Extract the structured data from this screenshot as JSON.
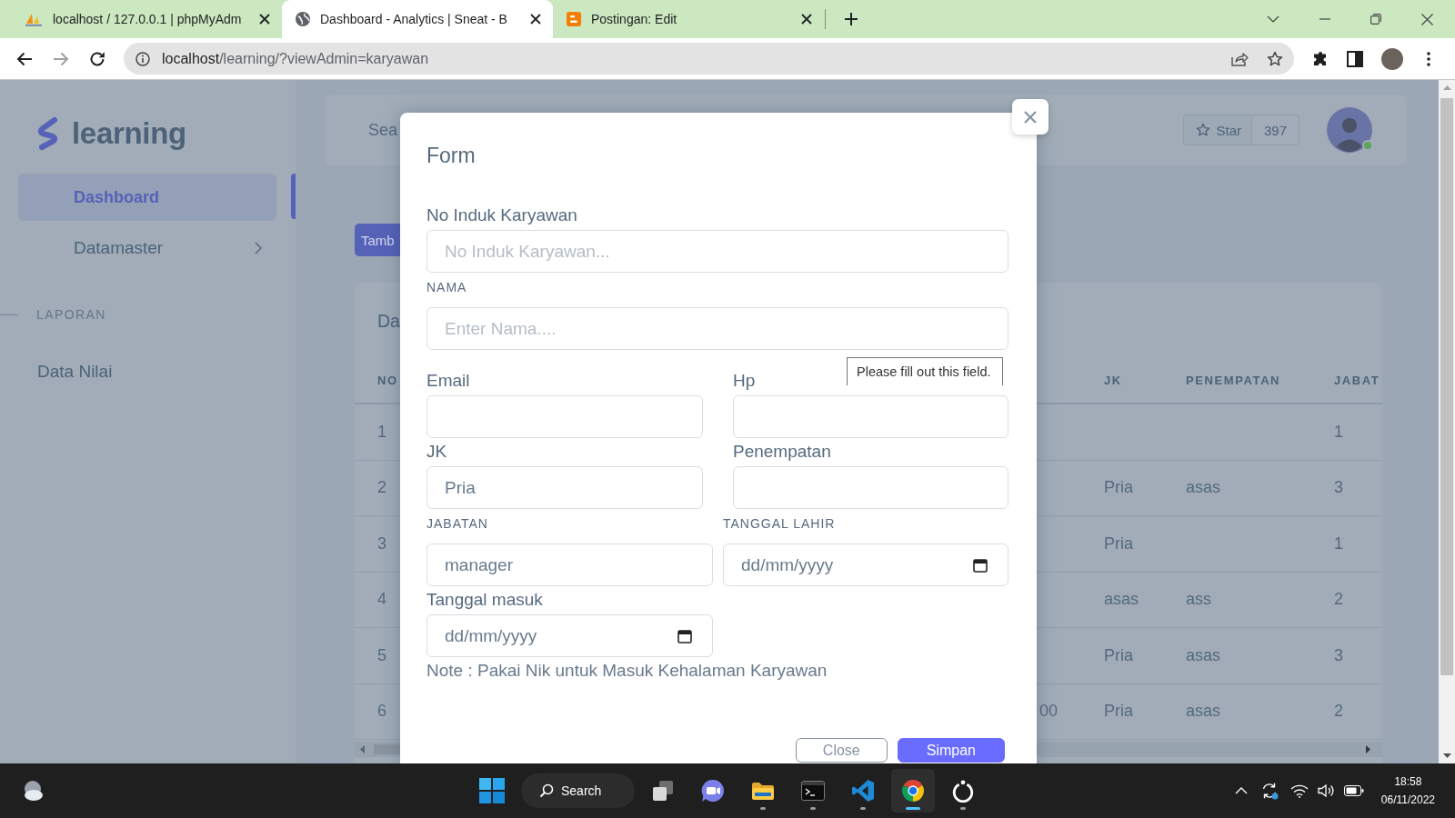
{
  "browser": {
    "tabs": [
      {
        "kind": "pma",
        "title": "localhost / 127.0.0.1 | phpMyAdm",
        "selected": false
      },
      {
        "kind": "globe",
        "title": "Dashboard - Analytics | Sneat - B",
        "selected": true
      },
      {
        "kind": "blog",
        "title": "Postingan: Edit",
        "selected": false
      }
    ],
    "url": "localhost/learning/?viewAdmin=karyawan"
  },
  "sidebar": {
    "logo": "learning",
    "items": [
      {
        "label": "Dashboard",
        "selected": true,
        "submenu": false
      },
      {
        "label": "Datamaster",
        "selected": false,
        "submenu": true
      }
    ],
    "section": "LAPORAN",
    "section_items": [
      {
        "label": "Data Nilai",
        "selected": false
      }
    ]
  },
  "navbar": {
    "search": {
      "placeholder": "Sea"
    },
    "star_label": "Star",
    "star_count": "397"
  },
  "add_button": "Tamb",
  "table": {
    "title": "Da",
    "columns": [
      "NO",
      "JK",
      "PENEMPATAN",
      "JABAT"
    ],
    "rows": [
      {
        "no": "1",
        "jabat": "1"
      },
      {
        "no": "2",
        "jk": "Pria",
        "penempatan": "asas",
        "jabat": "3"
      },
      {
        "no": "3",
        "jk": "Pria",
        "jabat": "1"
      },
      {
        "no": "4",
        "jk": "asas",
        "penempatan": "ass",
        "jabat": "2"
      },
      {
        "no": "5",
        "jk": "Pria",
        "penempatan": "asas",
        "jabat": "3"
      },
      {
        "no": "6",
        "column_2": "00",
        "jk": "Pria",
        "penempatan": "asas",
        "jabat": "2"
      }
    ]
  },
  "modal": {
    "title": "Form",
    "rows": [
      {
        "fields": [
          {
            "label": "No Induk Karyawan",
            "kind": "text",
            "placeholder": "No Induk Karyawan..."
          }
        ]
      },
      {
        "fields": [
          {
            "label": "NAMA",
            "kind": "text",
            "placeholder": "Enter Nama...."
          }
        ]
      },
      {
        "fields": [
          {
            "label": "Email",
            "kind": "text"
          },
          {
            "label": "Hp",
            "kind": "text"
          }
        ]
      },
      {
        "fields": [
          {
            "label": "JK",
            "kind": "text",
            "value": "Pria"
          },
          {
            "label": "Penempatan",
            "kind": "text"
          }
        ]
      },
      {
        "fields": [
          {
            "label": "JABATAN",
            "kind": "text",
            "value": "manager"
          },
          {
            "label": "TANGGAL LAHIR",
            "kind": "date",
            "value": "dd/mm/yyyy"
          }
        ]
      },
      {
        "fields": [
          {
            "label": "Tanggal masuk",
            "kind": "date",
            "value": "dd/mm/yyyy"
          }
        ]
      }
    ],
    "tooltip": "Please fill out this field.",
    "note": "Note : Pakai Nik untuk Masuk Kehalaman Karyawan",
    "buttons": [
      {
        "label": "Close",
        "kind": "secondary"
      },
      {
        "label": "Simpan",
        "kind": "primary"
      }
    ]
  },
  "taskbar": {
    "search": "Search",
    "apps": [
      {
        "kind": "taskview",
        "running": false,
        "selected": false
      },
      {
        "kind": "chat",
        "running": false,
        "selected": false
      },
      {
        "kind": "folder",
        "running": true,
        "selected": false
      },
      {
        "kind": "terminal",
        "running": true,
        "selected": false
      },
      {
        "kind": "code",
        "running": true,
        "selected": false
      },
      {
        "kind": "browser",
        "running": true,
        "selected": true
      },
      {
        "kind": "ring",
        "running": true,
        "selected": false
      }
    ],
    "time": "18:58",
    "date": "06/11/2022"
  }
}
